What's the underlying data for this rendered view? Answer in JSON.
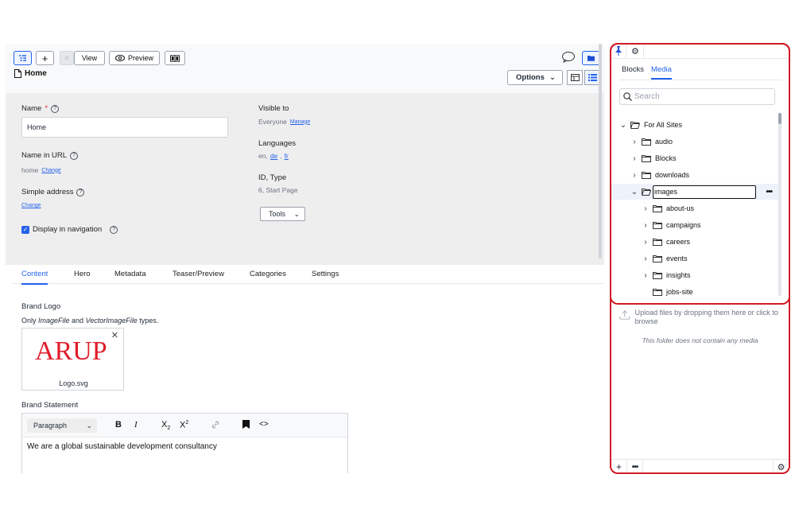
{
  "toolbar": {
    "view_label": "View",
    "preview_label": "Preview",
    "page_title": "Home",
    "options_label": "Options"
  },
  "props": {
    "name_label": "Name",
    "name_required": "*",
    "name_value": "Home",
    "url_label": "Name in URL",
    "url_value": "home",
    "url_action": "Change",
    "simple_label": "Simple address",
    "simple_action": "Change",
    "nav_label": "Display in navigation",
    "visible_label": "Visible to",
    "visible_value": "Everyone",
    "visible_action": "Manage",
    "languages_label": "Languages",
    "lang_prefix": "en,",
    "lang_de": "de",
    "lang_comma": ",",
    "lang_fr": "fr",
    "id_label": "ID, Type",
    "id_value": "6, Start Page",
    "tools_label": "Tools"
  },
  "tabs": [
    "Content",
    "Hero",
    "Metadata",
    "Teaser/Preview",
    "Categories",
    "Settings"
  ],
  "content": {
    "brand_logo_label": "Brand Logo",
    "hint_prefix": "Only ",
    "hint_type1": "ImageFile",
    "hint_and": " and ",
    "hint_type2": "VectorImageFile",
    "hint_suffix": " types.",
    "logo_text": "ARUP",
    "logo_file": "Logo.svg",
    "brand_statement_label": "Brand Statement",
    "paragraph_label": "Paragraph",
    "statement_text": "We are a global sustainable development consultancy"
  },
  "panel": {
    "tab_blocks": "Blocks",
    "tab_media": "Media",
    "search_placeholder": "Search",
    "tree": [
      {
        "label": "For All Sites",
        "level": 0,
        "state": "open"
      },
      {
        "label": "audio",
        "level": 1,
        "state": "closed"
      },
      {
        "label": "Blocks",
        "level": 1,
        "state": "closed"
      },
      {
        "label": "downloads",
        "level": 1,
        "state": "closed"
      },
      {
        "label": "images",
        "level": 1,
        "state": "open"
      },
      {
        "label": "about-us",
        "level": 2,
        "state": "closed"
      },
      {
        "label": "campaigns",
        "level": 2,
        "state": "closed"
      },
      {
        "label": "careers",
        "level": 2,
        "state": "closed"
      },
      {
        "label": "events",
        "level": 2,
        "state": "closed"
      },
      {
        "label": "insights",
        "level": 2,
        "state": "closed"
      },
      {
        "label": "jobs-site",
        "level": 2,
        "state": "leaf"
      }
    ],
    "upload_text": "Upload files by dropping them here or click to browse",
    "empty_text": "This folder does not contain any media"
  },
  "colors": {
    "accent": "#2563eb",
    "highlight_border": "#d01b26",
    "logo_red": "#e11d2a"
  }
}
